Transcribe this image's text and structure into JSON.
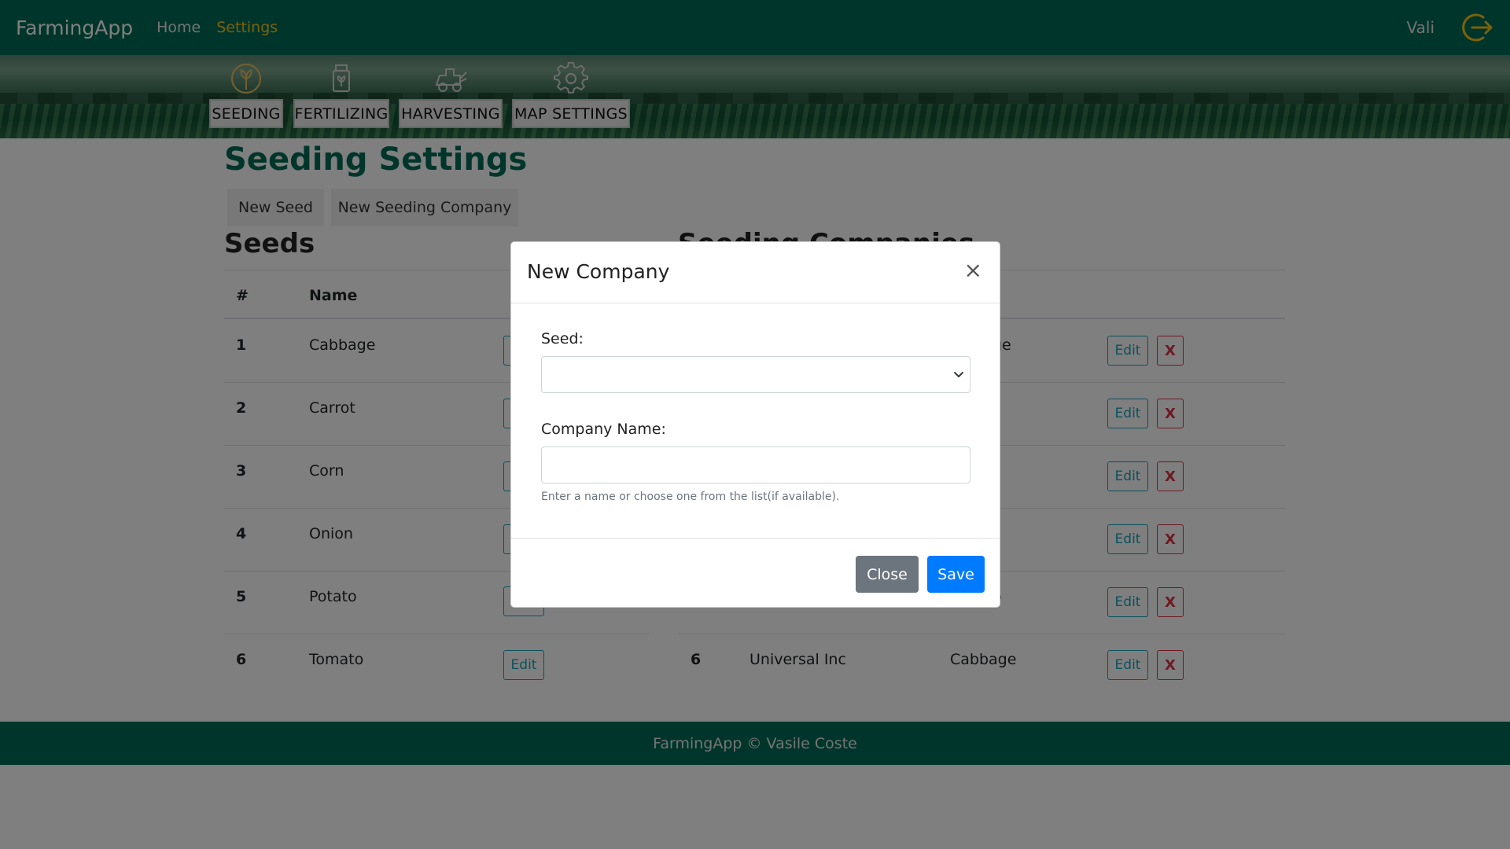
{
  "navbar": {
    "brand": "FarmingApp",
    "links": [
      "Home",
      "Settings"
    ],
    "active_link": "Settings",
    "user": "Vali",
    "logout_icon": "logout-icon",
    "accent": "#f5c518",
    "bg": "#006b57"
  },
  "tools": [
    {
      "label": "SEEDING",
      "icon": "seeding-icon"
    },
    {
      "label": "FERTILIZING",
      "icon": "fertilizer-icon"
    },
    {
      "label": "HARVESTING",
      "icon": "harvester-icon"
    },
    {
      "label": "MAP SETTINGS",
      "icon": "gear-icon"
    }
  ],
  "page": {
    "title": "Seeding Settings",
    "actions": [
      "New Seed",
      "New Seeding Company"
    ]
  },
  "seeds": {
    "heading": "Seeds",
    "columns": [
      "#",
      "Name"
    ],
    "rows": [
      {
        "num": "1",
        "name": "Cabbage"
      },
      {
        "num": "2",
        "name": "Carrot"
      },
      {
        "num": "3",
        "name": "Corn"
      },
      {
        "num": "4",
        "name": "Onion"
      },
      {
        "num": "5",
        "name": "Potato"
      },
      {
        "num": "6",
        "name": "Tomato"
      }
    ],
    "edit_label": "Edit"
  },
  "companies": {
    "heading_visible": "Seeding Companies",
    "rows_partial": [
      {
        "seed_fragment": "ge"
      },
      {
        "seed_fragment": ""
      },
      {
        "seed_fragment": ""
      },
      {
        "seed_fragment": ""
      },
      {
        "seed_fragment": "o"
      },
      {
        "num": "6",
        "name": "Universal Inc",
        "seed": "Cabbage"
      }
    ],
    "edit_label": "Edit",
    "delete_label": "X"
  },
  "footer": {
    "text": "FarmingApp © Vasile Coste"
  },
  "modal": {
    "title": "New Company",
    "close_glyph": "×",
    "seed_label": "Seed:",
    "seed_value": "",
    "company_label": "Company Name:",
    "company_value": "",
    "hint": "Enter a name or choose one from the list(if available).",
    "close_button": "Close",
    "save_button": "Save"
  }
}
